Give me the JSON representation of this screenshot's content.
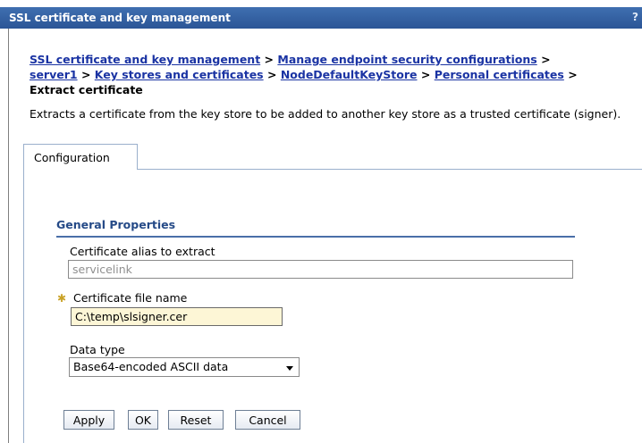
{
  "window": {
    "title": "SSL certificate and key management",
    "help_glyph": "?"
  },
  "breadcrumb": {
    "links": [
      "SSL certificate and key management",
      "Manage endpoint security configurations",
      "server1",
      "Key stores and certificates",
      "NodeDefaultKeyStore",
      "Personal certificates"
    ],
    "separator": ">",
    "current": "Extract certificate"
  },
  "description": "Extracts a certificate from the key store to be added to another key store as a trusted certificate (signer).",
  "tabs": [
    {
      "label": "Configuration"
    }
  ],
  "section": {
    "title": "General Properties"
  },
  "form": {
    "alias": {
      "label": "Certificate alias to extract",
      "value": "servicelink"
    },
    "file_name": {
      "label": "Certificate file name",
      "value": "C:\\temp\\slsigner.cer",
      "required": true
    },
    "data_type": {
      "label": "Data type",
      "selected": "Base64-encoded ASCII data"
    }
  },
  "buttons": {
    "apply": "Apply",
    "ok": "OK",
    "reset": "Reset",
    "cancel": "Cancel"
  },
  "colors": {
    "title_bar": "#2f5c9e",
    "link": "#1a33a3",
    "section_title": "#254a87",
    "input_highlight": "#fdf6d6"
  }
}
